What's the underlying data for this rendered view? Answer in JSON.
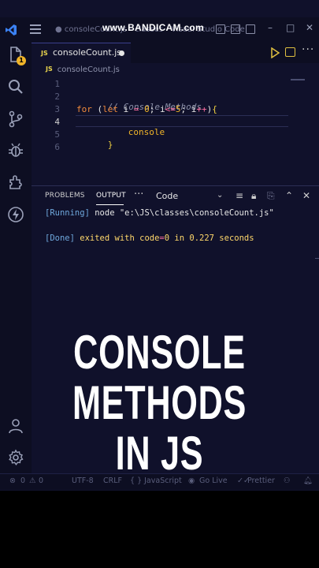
{
  "window": {
    "title": "● consoleCount.js - classes - Visual Studio Code",
    "watermark": "www.BANDICAM.com"
  },
  "activity_bar": {
    "explorer_badge": "1"
  },
  "editor": {
    "tab_label": "consoleCount.js",
    "tab_language_badge": "JS",
    "breadcrumb_badge": "JS",
    "breadcrumb": "consoleCount.js",
    "line_numbers": [
      "1",
      "2",
      "3",
      "4",
      "5",
      "6"
    ],
    "code": {
      "comment": "// Console Methods",
      "for_kw": "for",
      "open_paren": " (",
      "let_kw": "let",
      "var_i": " i ",
      "eq": "=",
      "zero": " 0",
      "semi1": "; i",
      "lte": "<=",
      "five": "5",
      "semi2": "; i",
      "incr": "++",
      "close_paren": ")",
      "open_brace": "{",
      "line4": "console",
      "close_brace": "}"
    }
  },
  "panel": {
    "tabs": [
      "PROBLEMS",
      "OUTPUT"
    ],
    "active_tab": "OUTPUT",
    "more": "···",
    "select_value": "Code",
    "output": {
      "running_tag": "[Running]",
      "running_text": " node \"e:\\JS\\classes\\consoleCount.js\"",
      "done_tag": "[Done]",
      "done_text1": " exited with ",
      "done_code": "code",
      "done_eq": "=",
      "done_zero": "0",
      "done_in": " in ",
      "done_time": "0.227",
      "done_seconds": " seconds"
    }
  },
  "caption": {
    "line1": "CONSOLE",
    "line2": "METHODS",
    "line3": "IN JS"
  },
  "status_bar": {
    "errors": "0",
    "warnings": "0",
    "encoding": "UTF-8",
    "eol": "CRLF",
    "language": "{ } JavaScript",
    "golive": "Go Live",
    "prettier": "Prettier"
  },
  "colors": {
    "background": "#10112b",
    "chrome": "#0d0e22",
    "accent_blue": "#3b82f6",
    "keyword": "#f08a3c",
    "operator": "#ff6ea1",
    "number": "#f0b429"
  }
}
